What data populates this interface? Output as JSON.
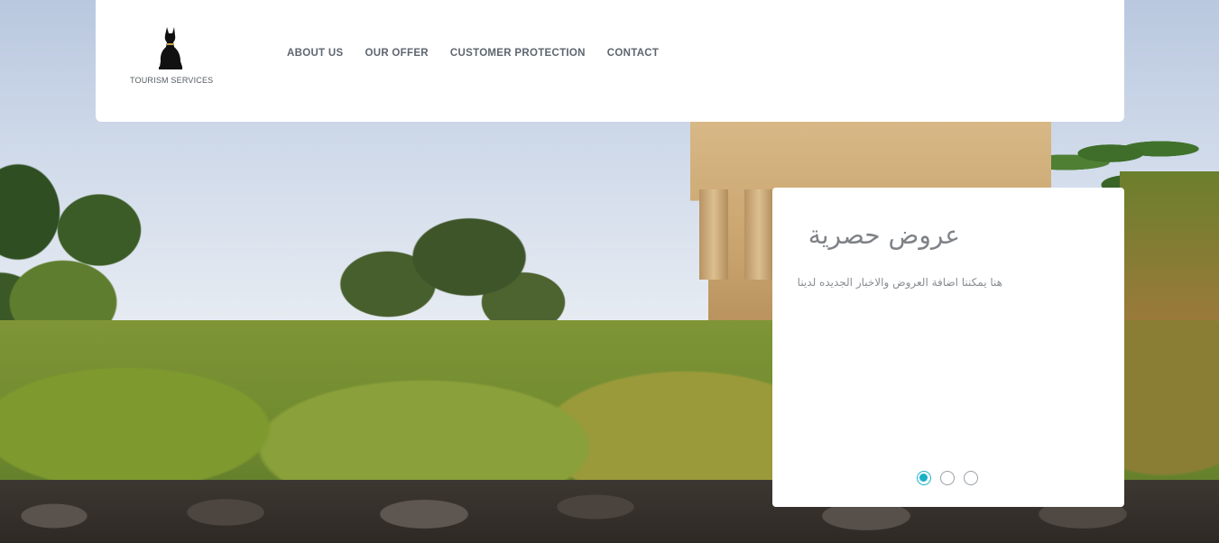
{
  "brand": {
    "logo_icon": "cat-statue-icon",
    "tagline": "TOURISM SERVICES"
  },
  "nav": {
    "items": [
      {
        "label": "ABOUT US"
      },
      {
        "label": "OUR OFFER"
      },
      {
        "label": "CUSTOMER PROTECTION"
      },
      {
        "label": "CONTACT"
      }
    ]
  },
  "offer": {
    "title": "عروض حصرية",
    "body": "هنا يمكننا اضافة العروض والاخبار الجديده لدينا"
  },
  "carousel": {
    "slide_count": 3,
    "active_index": 0
  },
  "colors": {
    "accent": "#1ab1c8",
    "nav_text": "#5d6670",
    "header_bg": "#ffffff"
  }
}
